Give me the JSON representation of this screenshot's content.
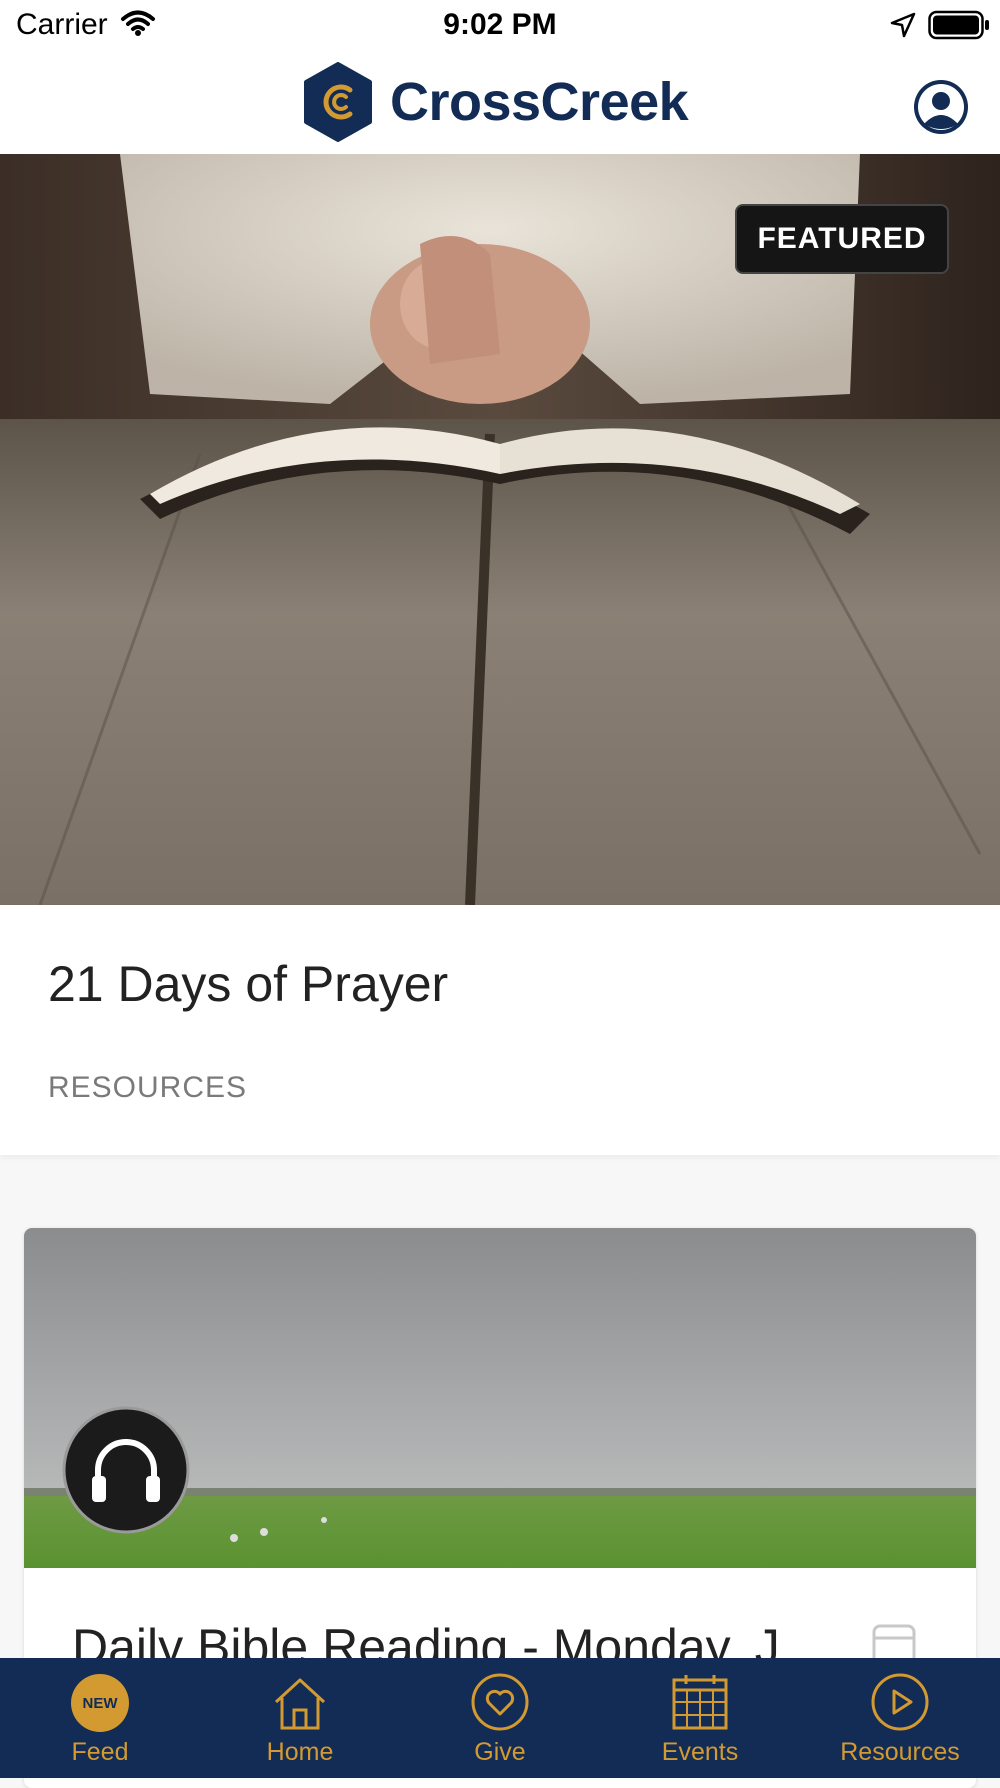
{
  "status_bar": {
    "carrier": "Carrier",
    "time": "9:02 PM"
  },
  "header": {
    "brand": "CrossCreek"
  },
  "featured": {
    "badge": "FEATURED",
    "title": "21 Days of Prayer",
    "category": "RESOURCES"
  },
  "feed_card": {
    "title": "Daily Bible Reading - Monday, J"
  },
  "tabbar": {
    "items": [
      {
        "label": "Feed",
        "badge": "NEW",
        "icon": "new-badge-icon"
      },
      {
        "label": "Home",
        "icon": "home-icon"
      },
      {
        "label": "Give",
        "icon": "heart-icon"
      },
      {
        "label": "Events",
        "icon": "calendar-icon"
      },
      {
        "label": "Resources",
        "icon": "play-icon"
      }
    ]
  },
  "colors": {
    "brand_navy": "#122c55",
    "accent_gold": "#d39a31"
  }
}
